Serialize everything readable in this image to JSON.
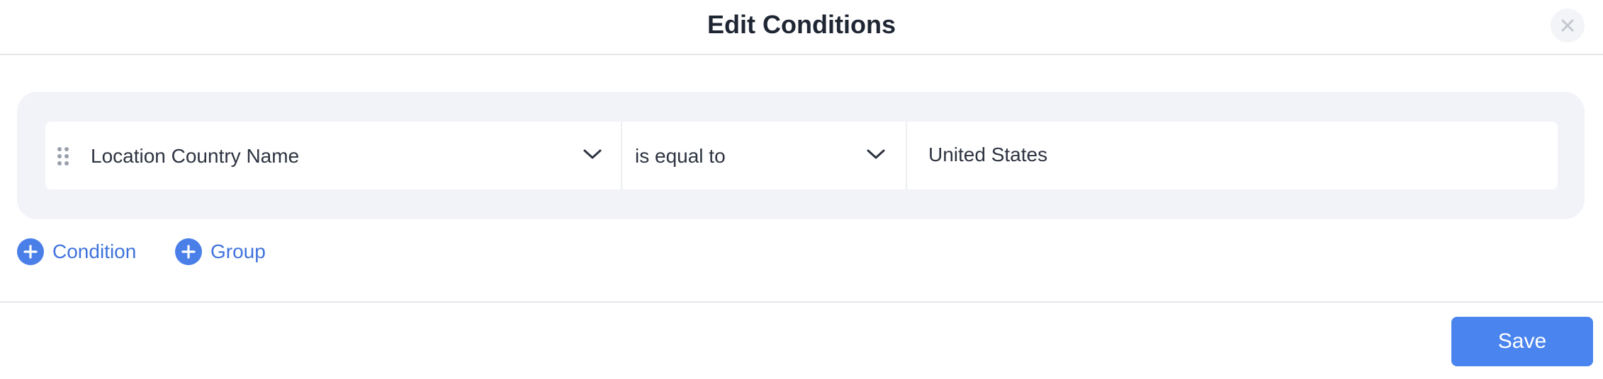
{
  "dialog": {
    "title": "Edit Conditions",
    "close_icon": "close-icon"
  },
  "condition": {
    "field": "Location Country Name",
    "operator": "is equal to",
    "value": "United States"
  },
  "actions": {
    "add_condition_label": "Condition",
    "add_group_label": "Group"
  },
  "footer": {
    "save_label": "Save"
  },
  "colors": {
    "accent": "#4a84ef",
    "link": "#3f73dc",
    "panel_bg": "#f1f3f9"
  }
}
